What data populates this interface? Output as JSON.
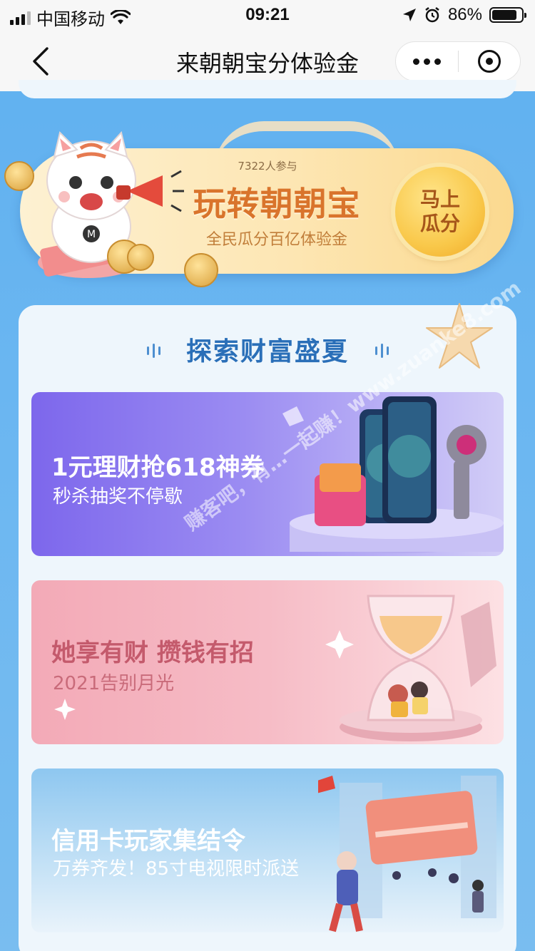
{
  "status_bar": {
    "carrier": "中国移动",
    "time": "09:21",
    "battery_percent": "86%",
    "battery_level": 0.86
  },
  "nav": {
    "title": "来朝朝宝分体验金"
  },
  "hero": {
    "participants": "7322人参与",
    "title": "玩转朝朝宝",
    "subtitle": "全民瓜分百亿体验金",
    "button_label": "马上瓜分"
  },
  "section": {
    "title": "探索财富盛夏"
  },
  "promos": [
    {
      "title": "1元理财抢618神券",
      "subtitle": "秒杀抽奖不停歇"
    },
    {
      "title": "她享有财 攒钱有招",
      "subtitle": "2021告别月光"
    },
    {
      "title": "信用卡玩家集结令",
      "subtitle": "万券齐发！85寸电视限时派送"
    }
  ],
  "watermark": "赚客吧，有…一起赚！www.zuanke8.com",
  "colors": {
    "page_bg": "#6ab6f1",
    "hero_accent": "#d9742c",
    "section_title": "#2a6fb8"
  }
}
